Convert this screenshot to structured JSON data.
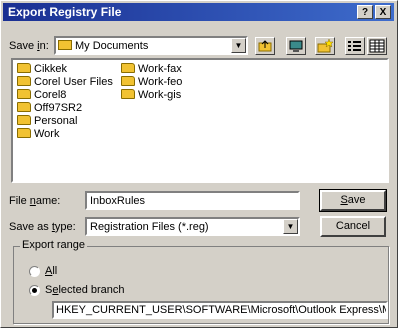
{
  "window": {
    "title": "Export Registry File",
    "help_label": "?",
    "close_label": "X"
  },
  "save_in": {
    "label_pre": "Save ",
    "label_ul": "i",
    "label_post": "n:",
    "value": "My Documents"
  },
  "toolbar": {
    "icons": [
      "up-one-level-icon",
      "desktop-icon",
      "new-folder-icon",
      "list-view-icon",
      "details-view-icon"
    ]
  },
  "files": [
    "Cikkek",
    "Corel User Files",
    "Corel8",
    "Off97SR2",
    "Personal",
    "Work",
    "Work-fax",
    "Work-feo",
    "Work-gis"
  ],
  "file_name": {
    "label_pre": "File ",
    "label_ul": "n",
    "label_post": "ame:",
    "value": "InboxRules"
  },
  "save_as_type": {
    "label_pre": "Save as ",
    "label_ul": "t",
    "label_post": "ype:",
    "value": "Registration Files (*.reg)"
  },
  "buttons": {
    "save_ul": "S",
    "save_rest": "ave",
    "cancel": "Cancel"
  },
  "export_range": {
    "legend": "Export range",
    "all_ul": "A",
    "all_rest": "ll",
    "selected_pre": "S",
    "selected_ul": "e",
    "selected_rest": "lected branch",
    "selected": "Selected branch",
    "branch_value": "HKEY_CURRENT_USER\\SOFTWARE\\Microsoft\\Outlook Express\\Mail\\"
  },
  "colors": {
    "titlebar_start": "#1a2f92",
    "titlebar_end": "#3e6ccc",
    "dialog_face": "#d4d0c8",
    "folder_fill": "#f1c232"
  }
}
